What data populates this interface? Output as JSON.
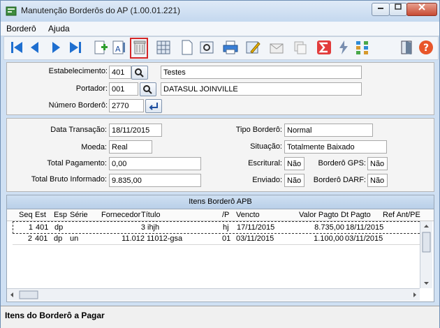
{
  "window": {
    "title": "Manutenção Borderôs do AP (1.00.01.221)"
  },
  "menu": {
    "items": [
      "Borderô",
      "Ajuda"
    ]
  },
  "toolbar": {
    "icons": [
      "first-icon",
      "prev-icon",
      "next-icon",
      "last-icon",
      "add-icon",
      "edit-text-icon",
      "delete-icon",
      "grid-icon",
      "document-icon",
      "preview-icon",
      "print-icon",
      "edit-form-icon",
      "envelope-icon",
      "copy-icon",
      "sum-icon",
      "lightning-icon",
      "tree-icon",
      "exit-door-icon",
      "help-icon"
    ],
    "selected": "delete-icon"
  },
  "header": {
    "estabelecimento": {
      "label": "Estabelecimento:",
      "code": "401",
      "desc": "Testes"
    },
    "portador": {
      "label": "Portador:",
      "code": "001",
      "desc": "DATASUL JOINVILLE"
    },
    "numero": {
      "label": "Número Borderô:",
      "value": "2770"
    }
  },
  "details": {
    "data_transacao": {
      "label": "Data Transação:",
      "value": "18/11/2015"
    },
    "moeda": {
      "label": "Moeda:",
      "value": "Real"
    },
    "total_pagamento": {
      "label": "Total Pagamento:",
      "value": "0,00"
    },
    "total_bruto": {
      "label": "Total Bruto Informado:",
      "value": "9.835,00"
    },
    "tipo_bordero": {
      "label": "Tipo Borderô:",
      "value": "Normal"
    },
    "situacao": {
      "label": "Situação:",
      "value": "Totalmente Baixado"
    },
    "escritural": {
      "label": "Escritural:",
      "value": "Não"
    },
    "enviado": {
      "label": "Enviado:",
      "value": "Não"
    },
    "bordero_gps": {
      "label": "Borderô GPS:",
      "value": "Não"
    },
    "bordero_darf": {
      "label": "Borderô DARF:",
      "value": "Não"
    }
  },
  "grid": {
    "title": "Itens Borderô APB",
    "columns": [
      "Seq",
      "Est",
      "Esp",
      "Série",
      "Fornecedor",
      "Título",
      "/P",
      "Vencto",
      "Valor Pagto",
      "Dt Pagto",
      "Ref Ant/PE"
    ],
    "rows": [
      [
        "1",
        "401",
        "dp",
        "",
        "3",
        "ihjh",
        "hj",
        "17/11/2015",
        "8.735,00",
        "18/11/2015",
        ""
      ],
      [
        "2",
        "401",
        "dp",
        "un",
        "11.012",
        "11012-gsa",
        "01",
        "03/11/2015",
        "1.100,00",
        "03/11/2015",
        ""
      ]
    ]
  },
  "status": {
    "text": "Itens do Borderô a Pagar"
  },
  "colors": {
    "title_bg": "#c4d8ef",
    "grid_title_bg": "#b9cfe8",
    "selection_border": "#d42626"
  }
}
